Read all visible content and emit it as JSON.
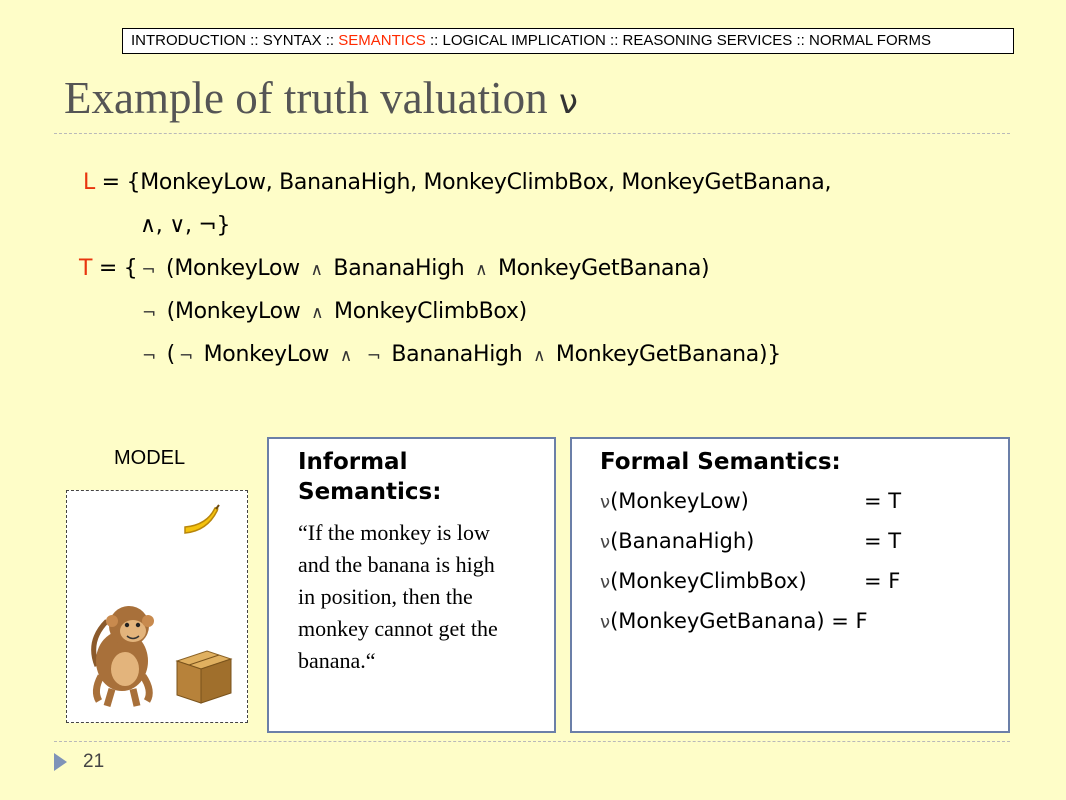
{
  "nav": {
    "items": [
      "INTRODUCTION",
      "SYNTAX",
      "SEMANTICS",
      "LOGICAL IMPLICATION",
      "REASONING SERVICES",
      "NORMAL FORMS"
    ],
    "separator": "::",
    "active": "SEMANTICS"
  },
  "title": {
    "text": "Example of truth valuation",
    "symbol": "ν"
  },
  "language": {
    "var": "L",
    "line1": "= {MonkeyLow, BananaHigh, MonkeyClimbBox, MonkeyGetBanana,",
    "line2": "∧, ∨, ¬}"
  },
  "theory": {
    "var": "T",
    "eq": "= {",
    "neg": "¬",
    "and": "∧",
    "r1": [
      "(MonkeyLow",
      "BananaHigh",
      "MonkeyGetBanana)"
    ],
    "r2": [
      "(MonkeyLow",
      "MonkeyClimbBox)"
    ],
    "r3": [
      "(",
      "MonkeyLow",
      "BananaHigh",
      "MonkeyGetBanana)}"
    ]
  },
  "model": {
    "label": "MODEL",
    "icons": [
      "banana-icon",
      "monkey-icon",
      "box-icon"
    ]
  },
  "informal": {
    "heading_line1": "Informal",
    "heading_line2": "Semantics:",
    "quote_lines": [
      "“If the monkey is low",
      "and the banana is high",
      "in position, then the",
      "monkey cannot get the",
      "banana.“"
    ]
  },
  "formal": {
    "heading": "Formal Semantics:",
    "nu": "ν",
    "rows": [
      {
        "arg": "(MonkeyLow)",
        "val": "= T"
      },
      {
        "arg": "(BananaHigh)",
        "val": "= T"
      },
      {
        "arg": "(MonkeyClimbBox)",
        "val": "= F"
      },
      {
        "arg": "(MonkeyGetBanana) = F",
        "val": ""
      }
    ]
  },
  "footer": {
    "page": "21"
  },
  "colors": {
    "background": "#fefdc8",
    "accent_red": "#e8350e",
    "panel_border": "#6b7fa8"
  }
}
